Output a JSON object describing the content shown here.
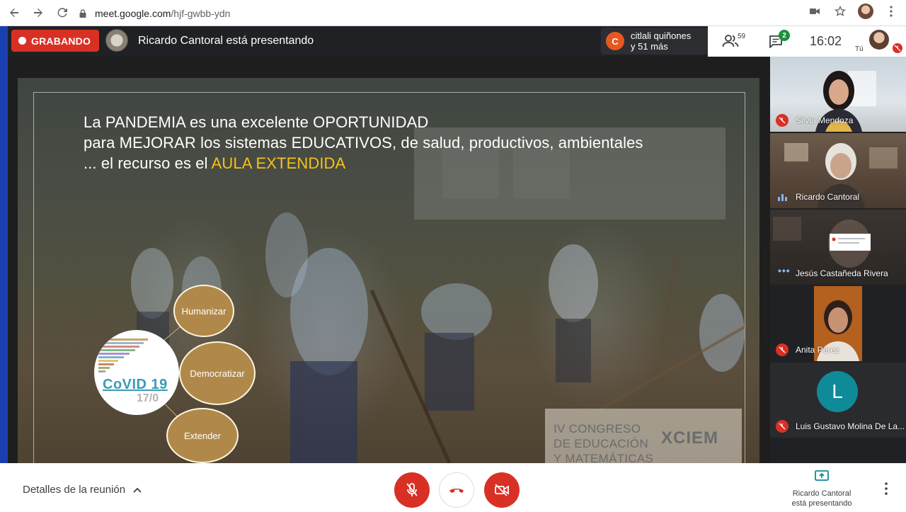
{
  "browser": {
    "url_host": "meet.google.com",
    "url_path": "/hjf-gwbb-ydn"
  },
  "meet_top": {
    "recording_label": "GRABANDO",
    "presenter_text": "Ricardo Cantoral está presentando",
    "chat_notification": {
      "avatar_letter": "C",
      "line1": "citlali quiñones",
      "line2": "y 51 más"
    },
    "participants_count": "59",
    "chat_count": "2",
    "clock": "16:02",
    "self_label": "Tú"
  },
  "slide": {
    "title_line1": "La PANDEMIA es una excelente OPORTUNIDAD",
    "title_line2": "para MEJORAR los sistemas EDUCATIVOS, de salud, productivos, ambientales",
    "title_line3_prefix": "... el recurso es el ",
    "title_line3_accent": "AULA EXTENDIDA",
    "bubbles": [
      "Humanizar",
      "Democratizar",
      "Extender"
    ],
    "covid_title": "CoVID 19",
    "covid_date": "17/0",
    "congress_lines": [
      "IV CONGRESO",
      "DE EDUCACIÓN",
      "Y MATEMÁTICAS"
    ],
    "congress_logo": "XCIEM"
  },
  "participants": [
    {
      "name": "Silvia Mendoza",
      "status": "muted"
    },
    {
      "name": "Ricardo Cantoral",
      "status": "speaking"
    },
    {
      "name": "Jesús Castañeda Rivera",
      "status": "active"
    },
    {
      "name": "Anita Perez",
      "status": "muted"
    },
    {
      "name": "Luis Gustavo Molina De La...",
      "status": "muted",
      "avatar_letter": "L"
    }
  ],
  "bottom": {
    "meeting_details": "Detalles de la reunión",
    "present_line1": "Ricardo Cantoral",
    "present_line2": "está presentando"
  },
  "colors": {
    "recording_red": "#d93025",
    "accent_yellow": "#f4c21a",
    "teal_avatar": "#0f8a99"
  }
}
